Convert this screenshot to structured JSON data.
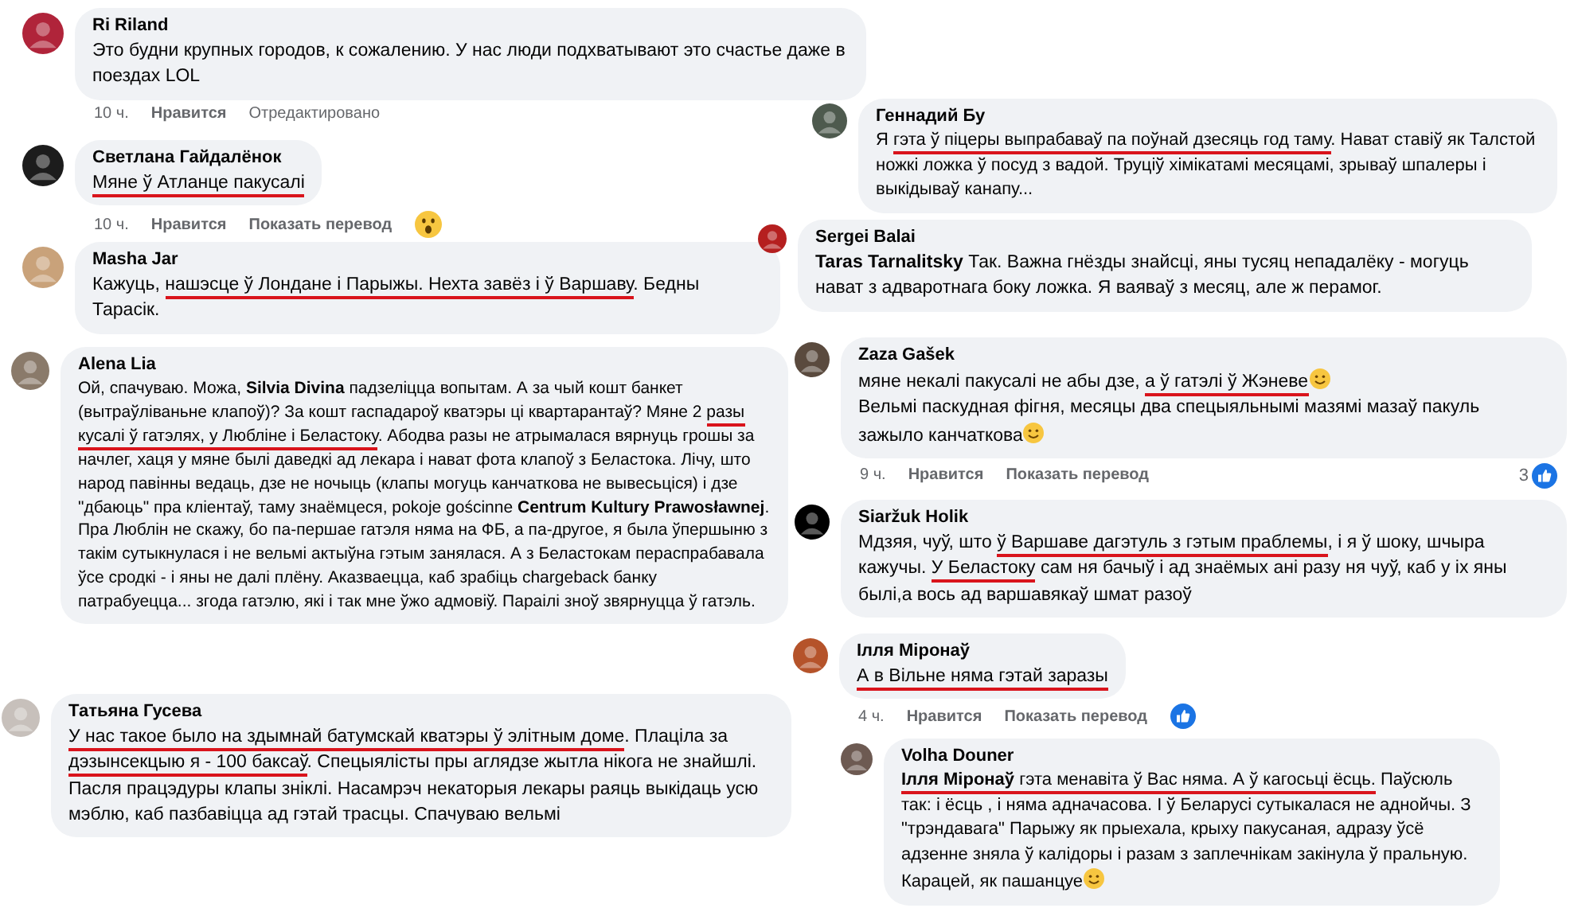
{
  "comments": [
    {
      "author": "Ri Riland",
      "segments": [
        {
          "kind": "text",
          "text": "Это будни крупных городов, к сожалению. У нас люди подхватывают это счастье даже в поездах LOL",
          "underlined": false
        }
      ],
      "meta": [
        {
          "kind": "time",
          "text": "10 ч."
        },
        {
          "kind": "action",
          "text": "Нравится"
        },
        {
          "kind": "note",
          "text": "Отредактировано"
        }
      ]
    },
    {
      "author": "Светлана Гайдалёнок",
      "segments": [
        {
          "kind": "text",
          "text": "Мяне ў Атланце пакусалі",
          "underlined": true
        }
      ],
      "meta": [
        {
          "kind": "time",
          "text": "10 ч."
        },
        {
          "kind": "action",
          "text": "Нравится"
        },
        {
          "kind": "action",
          "text": "Показать перевод"
        }
      ],
      "reaction": {
        "kind": "wow"
      }
    },
    {
      "author": "Masha Jar",
      "segments": [
        {
          "kind": "text",
          "text": "Кажуць, ",
          "underlined": false
        },
        {
          "kind": "text",
          "text": "нашэсце ў Лондане і Парыжы. Нехта завёз і ў Варшаву",
          "underlined": true
        },
        {
          "kind": "text",
          "text": ". Бедны Тарасік.",
          "underlined": false
        }
      ]
    },
    {
      "author": "Геннадий Бу",
      "segments": [
        {
          "kind": "text",
          "text": "Я ",
          "underlined": false
        },
        {
          "kind": "text",
          "text": "гэта ў піцеры выпрабаваў па поўнай дзесяць год таму",
          "underlined": true
        },
        {
          "kind": "text",
          "text": ". Нават ставіў як Талстой ножкі ложка ў посуд з вадой. Труціў хімікатамі месяцамі, зрываў шпалеры і выкідываў канапу...",
          "underlined": false
        }
      ]
    },
    {
      "author": "Sergei Balai",
      "segments": [
        {
          "kind": "text",
          "text": "**Taras Tarnalitsky** Так. Важна гнёзды знайсці, яны тусяц непадалёку - могуць нават з адваротнага боку ложка. Я ваяваў з месяц, але ж перамог.",
          "underlined": false
        }
      ]
    },
    {
      "author": "Alena Lia",
      "segments": [
        {
          "kind": "text",
          "text": "Ой, спачуваю. Можа, **Silvia Divina** падзеліцца вопытам. А за чый кошт банкет (вытраўліваньне клапоў)? За кошт гаспадароў кватэры ці квартарантаў? Мяне 2 ",
          "underlined": false
        },
        {
          "kind": "text",
          "text": "разы кусалі ў гатэлях, у Любліне і Беластоку",
          "underlined": true
        },
        {
          "kind": "text",
          "text": ". Абодва разы не атрымалася вярнуць грошы за начлег, хаця у мяне былі даведкі ад лекара і нават фота клапоў з Беластока. Лічу, што народ павінны ведаць, дзе не ночыць (клапы могуць канчаткова не вывесьціся) і дзе \"дбаюць\" пра кліентаў, таму знаёмцеся, pokoje gościnne **Centrum Kultury Prawosławnej**. Пра Люблін не скажу, бо па-першае гатэля няма на ФБ, а па-другое, я была ўпершыню з такім сутыкнулася і не вельмі актыўна гэтым занялася. А з Беластокам пераспрабавала ўсе сродкі - і яны не далі плёну. Аказваецца, каб зрабіць chargeback банку патрабуецца... згода гатэлю, які і так мне ўжо адмовіў. Параілі зноў звярнуцца ў гатэль.",
          "underlined": false
        }
      ]
    },
    {
      "author": "Татьяна Гусева",
      "segments": [
        {
          "kind": "text",
          "text": "У нас такое было на здымнай батумскай кватэры ў элітным доме",
          "underlined": true
        },
        {
          "kind": "text",
          "text": ". Плаціла за ",
          "underlined": false
        },
        {
          "kind": "text",
          "text": "дэзынсекцыю я - 100 баксаў",
          "underlined": true
        },
        {
          "kind": "text",
          "text": ". Спецыялісты пры аглядзе жытла нікога не знайшлі. Пасля працэдуры клапы зніклі. Насамрэч некаторыя лекары раяць выкідаць усю мэблю, каб пазбавіцца ад гэтай трасцы. Спачуваю вельмі",
          "underlined": false
        }
      ]
    },
    {
      "author": "Zaza Gašek",
      "segments": [
        {
          "kind": "text",
          "text": "мяне некалі пакусалі не абы дзе, ",
          "underlined": false
        },
        {
          "kind": "text",
          "text": "а ў гатэлі ў Жэневе",
          "underlined": true
        },
        {
          "kind": "emoji",
          "underlined": false
        },
        {
          "kind": "text",
          "text": "\nВельмі паскудная фігня, месяцы два спецыяльнымі мазямі мазаў пакуль зажыло канчаткова",
          "underlined": false
        },
        {
          "kind": "emoji",
          "underlined": false
        }
      ],
      "meta": [
        {
          "kind": "time",
          "text": "9 ч."
        },
        {
          "kind": "action",
          "text": "Нравится"
        },
        {
          "kind": "action",
          "text": "Показать перевод"
        }
      ],
      "reaction": {
        "kind": "like",
        "count": "3"
      }
    },
    {
      "author": "Siaržuk Holik",
      "segments": [
        {
          "kind": "text",
          "text": "Мдзяя, чуў, што ",
          "underlined": false
        },
        {
          "kind": "text",
          "text": "ў Варшаве дагэтуль з гэтым праблемы",
          "underlined": true
        },
        {
          "kind": "text",
          "text": ", і я ў шоку, шчыра кажучы. ",
          "underlined": false
        },
        {
          "kind": "text",
          "text": "У Беластоку",
          "underlined": true
        },
        {
          "kind": "text",
          "text": " сам ня бачыў і ад знаёмых ані разу ня чуў, каб у іх яны былі,а вось ад варшавякаў шмат разоў",
          "underlined": false
        }
      ]
    },
    {
      "author": "Ілля Міронаў",
      "segments": [
        {
          "kind": "text",
          "text": "А в Вільне няма гэтай заразы",
          "underlined": true
        }
      ],
      "meta": [
        {
          "kind": "time",
          "text": "4 ч."
        },
        {
          "kind": "action",
          "text": "Нравится"
        },
        {
          "kind": "action",
          "text": "Показать перевод"
        }
      ],
      "reaction": {
        "kind": "like"
      }
    },
    {
      "author": "Volha Douner",
      "segments": [
        {
          "kind": "text",
          "text": "**Ілля Міронаў** гэта менавіта ў Вас няма. А ў кагосьці ёсць.",
          "underlined": true
        },
        {
          "kind": "text",
          "text": " Паўсюль так: і ёсць , і няма адначасова. І ў Беларусі сутыкалася не аднойчы. З \"трэндавага\" Парыжу як прыехала, крыху пакусаная, адразу ўсё адзенне зняла ў калідоры і разам з заплечнікам закінула ў пральную. Карацей, як пашанцуе",
          "underlined": false
        },
        {
          "kind": "emoji",
          "underlined": false
        }
      ]
    }
  ]
}
